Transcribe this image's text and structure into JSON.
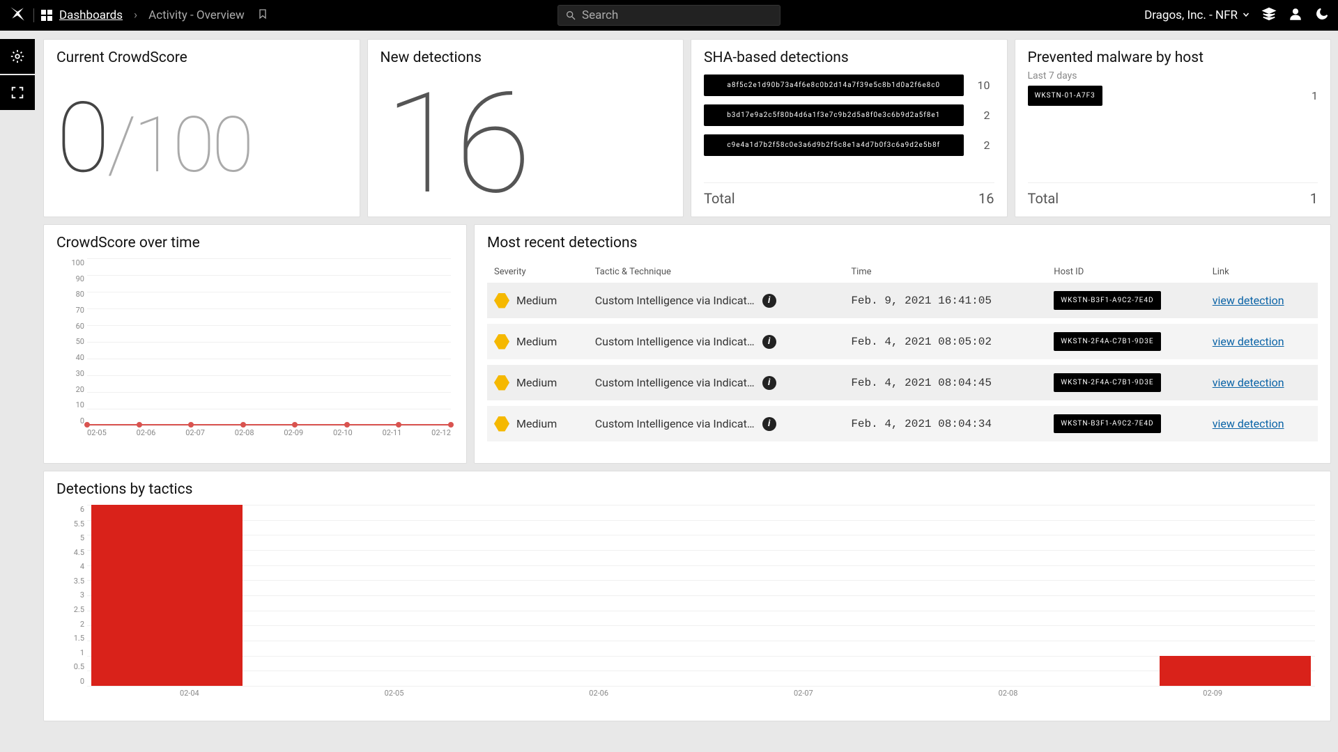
{
  "topbar": {
    "crumb_root": "Dashboards",
    "crumb_current": "Activity - Overview",
    "search_placeholder": "Search",
    "org_name": "Dragos, Inc. - NFR"
  },
  "cards": {
    "crowdscore": {
      "title": "Current CrowdScore",
      "value": "0",
      "sep": "/",
      "max": "100"
    },
    "newdet": {
      "title": "New detections",
      "value": "16"
    },
    "sha": {
      "title": "SHA-based detections",
      "rows": [
        {
          "hash": "a8f5c2e1d90b73a4f6e8c0b2d14a7f39e5c8b1d0a2f6e8c0",
          "count": "10"
        },
        {
          "hash": "b3d17e9a2c5f80b4d6a1f3e7c9b2d5a8f0e3c6b9d2a5f8e1",
          "count": "2"
        },
        {
          "hash": "c9e4a1d7b2f58c0e3a6d9b2f5c8e1a4d7b0f3c6a9d2e5b8f",
          "count": "2"
        }
      ],
      "total_label": "Total",
      "total_value": "16"
    },
    "prevented": {
      "title": "Prevented malware by host",
      "subtitle": "Last 7 days",
      "rows": [
        {
          "host": "WKSTN-01-A7F3",
          "count": "1"
        }
      ],
      "total_label": "Total",
      "total_value": "1"
    },
    "cot": {
      "title": "CrowdScore over time"
    },
    "recent": {
      "title": "Most recent detections",
      "headers": {
        "sev": "Severity",
        "tt": "Tactic & Technique",
        "time": "Time",
        "host": "Host ID",
        "link": "Link"
      },
      "rows": [
        {
          "severity": "Medium",
          "tt": "Custom Intelligence via Indicat...",
          "time": "Feb.  9, 2021 16:41:05",
          "host": "WKSTN-B3F1-A9C2-7E4D",
          "link": "view detection"
        },
        {
          "severity": "Medium",
          "tt": "Custom Intelligence via Indicat...",
          "time": "Feb.  4, 2021 08:05:02",
          "host": "WKSTN-2F4A-C7B1-9D3E",
          "link": "view detection"
        },
        {
          "severity": "Medium",
          "tt": "Custom Intelligence via Indicat...",
          "time": "Feb.  4, 2021 08:04:45",
          "host": "WKSTN-2F4A-C7B1-9D3E",
          "link": "view detection"
        },
        {
          "severity": "Medium",
          "tt": "Custom Intelligence via Indicat...",
          "time": "Feb.  4, 2021 08:04:34",
          "host": "WKSTN-B3F1-A9C2-7E4D",
          "link": "view detection"
        }
      ]
    },
    "tactics": {
      "title": "Detections by tactics"
    }
  },
  "chart_data": [
    {
      "id": "crowdscore_over_time",
      "type": "line",
      "x": [
        "02-05",
        "02-06",
        "02-07",
        "02-08",
        "02-09",
        "02-10",
        "02-11",
        "02-12"
      ],
      "values": [
        0,
        0,
        0,
        0,
        0,
        0,
        0,
        0
      ],
      "ylim": [
        0,
        100
      ],
      "yticks": [
        0,
        10,
        20,
        30,
        40,
        50,
        60,
        70,
        80,
        90,
        100
      ],
      "title": "CrowdScore over time",
      "xlabel": "",
      "ylabel": ""
    },
    {
      "id": "detections_by_tactics",
      "type": "bar",
      "categories": [
        "02-04",
        "02-05",
        "02-06",
        "02-07",
        "02-08",
        "02-09"
      ],
      "values": [
        6,
        0,
        0,
        0,
        0,
        1
      ],
      "ylim": [
        0,
        6
      ],
      "yticks": [
        0,
        0.5,
        1,
        1.5,
        2,
        2.5,
        3,
        3.5,
        4,
        4.5,
        5,
        5.5,
        6
      ],
      "title": "Detections by tactics",
      "xlabel": "",
      "ylabel": ""
    }
  ]
}
